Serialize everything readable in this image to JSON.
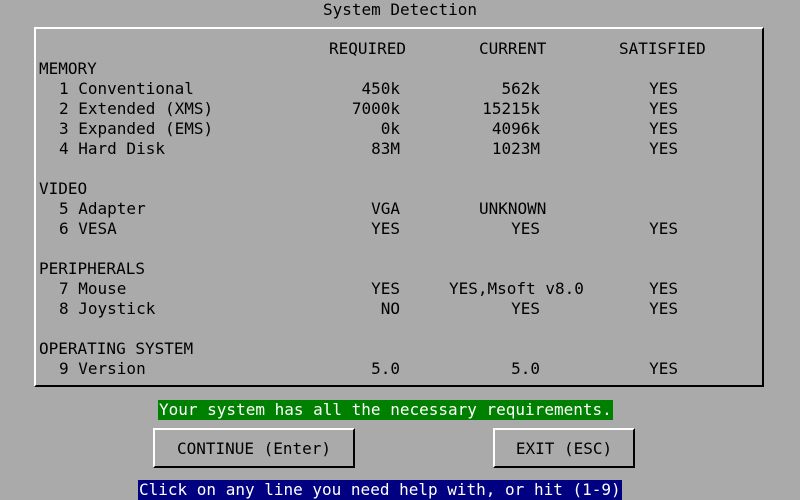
{
  "window": {
    "title": "System Detection"
  },
  "headers": {
    "required": "REQUIRED",
    "current": "CURRENT",
    "satisfied": "SATISFIED"
  },
  "sections": [
    {
      "name": "MEMORY",
      "items": [
        {
          "label": "1 Conventional",
          "required": "450k",
          "current": "562k",
          "satisfied": "YES"
        },
        {
          "label": "2 Extended (XMS)",
          "required": "7000k",
          "current": "15215k",
          "satisfied": "YES"
        },
        {
          "label": "3 Expanded (EMS)",
          "required": "0k",
          "current": "4096k",
          "satisfied": "YES"
        },
        {
          "label": "4 Hard Disk",
          "required": "83M",
          "current": "1023M",
          "satisfied": "YES"
        }
      ]
    },
    {
      "name": "VIDEO",
      "items": [
        {
          "label": "5 Adapter",
          "required": "VGA",
          "current": "UNKNOWN",
          "satisfied": ""
        },
        {
          "label": "6 VESA",
          "required": "YES",
          "current": "YES",
          "satisfied": "YES"
        }
      ]
    },
    {
      "name": "PERIPHERALS",
      "items": [
        {
          "label": "7 Mouse",
          "required": "YES",
          "current": "YES,Msoft v8.0",
          "satisfied": "YES"
        },
        {
          "label": "8 Joystick",
          "required": "NO",
          "current": "YES",
          "satisfied": "YES"
        }
      ]
    },
    {
      "name": "OPERATING SYSTEM",
      "items": [
        {
          "label": "9 Version",
          "required": "5.0",
          "current": "5.0",
          "satisfied": "YES"
        }
      ]
    }
  ],
  "status_message": "Your system has all the necessary requirements.",
  "buttons": {
    "continue": "CONTINUE (Enter)",
    "exit": "EXIT (ESC)"
  },
  "help_text": "Click on any line you need help with, or hit (1-9)",
  "colors": {
    "background": "#aaaaaa",
    "status_bg": "#008000",
    "help_bg": "#000080",
    "text": "#000000"
  }
}
